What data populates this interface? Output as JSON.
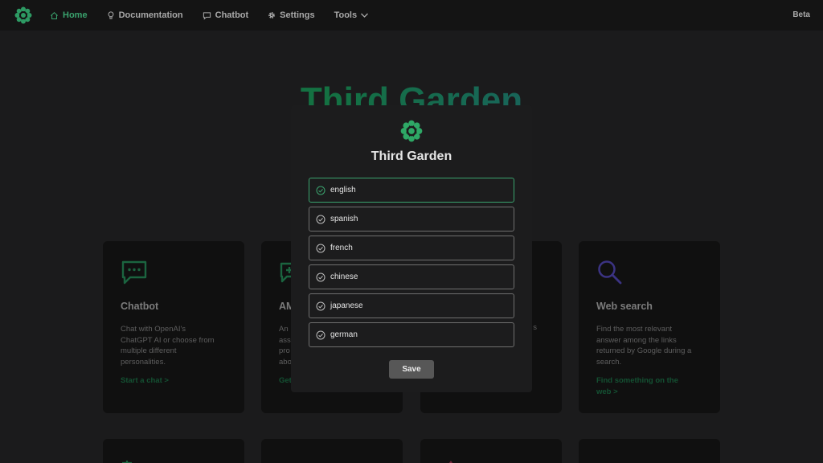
{
  "navbar": {
    "logo_icon": "flower-logo-icon",
    "items": [
      {
        "label": "Home",
        "icon": "home-icon",
        "active": true
      },
      {
        "label": "Documentation",
        "icon": "lightbulb-icon"
      },
      {
        "label": "Chatbot",
        "icon": "chat-bubble-icon"
      },
      {
        "label": "Settings",
        "icon": "gear-icon"
      },
      {
        "label": "Tools",
        "icon": "chevron-down-icon"
      }
    ],
    "beta": "Beta"
  },
  "background": {
    "title": "Third Garden",
    "cards": [
      {
        "title": "Chatbot",
        "icon": "chat-icon",
        "desc_lines": [
          "Chat with OpenAI's",
          "ChatGPT AI or choose from",
          "multiple different",
          "personalities."
        ],
        "link": "Start a chat >"
      },
      {
        "title": "AM",
        "icon": "chat-plus-icon",
        "desc_lines": [
          "An",
          "ass",
          "pro",
          "abo"
        ],
        "link": "Get"
      },
      {
        "title": "",
        "icon": "",
        "desc_lines": [
          "",
          "s"
        ],
        "link": ""
      },
      {
        "title": "Web search",
        "icon": "magnifier-icon",
        "desc_lines": [
          "Find the most relevant",
          "answer among the links",
          "returned by Google during a",
          "search."
        ],
        "link_lines": [
          "Find something on the",
          "web >"
        ]
      }
    ]
  },
  "colors": {
    "accent_green": "#3aa36e",
    "link_green": "#1f7d4e",
    "search_purple": "#5b4fc9",
    "background": "#2a2a2b",
    "card": "#19191a"
  },
  "modal": {
    "logo_icon": "flower-logo-icon",
    "title": "Third Garden",
    "options": [
      {
        "label": "english",
        "selected": true
      },
      {
        "label": "spanish"
      },
      {
        "label": "french"
      },
      {
        "label": "chinese"
      },
      {
        "label": "japanese"
      },
      {
        "label": "german"
      }
    ],
    "save_label": "Save"
  }
}
